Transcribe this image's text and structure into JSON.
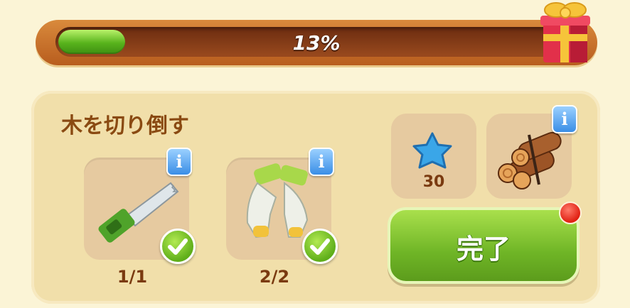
{
  "progress": {
    "label": "13%",
    "value": 0.13
  },
  "task": {
    "title": "木を切り倒す"
  },
  "requirements": [
    {
      "item": "saw-icon",
      "count": "1/1",
      "completed": true
    },
    {
      "item": "gloves-icon",
      "count": "2/2",
      "completed": true
    }
  ],
  "rewards": [
    {
      "item": "blue-star-icon",
      "amount": "30"
    },
    {
      "item": "logs-icon",
      "amount": ""
    }
  ],
  "complete_button": {
    "label": "完了"
  },
  "colors": {
    "accent_green": "#6fb526",
    "title_brown": "#8a4a12",
    "info_blue": "#3a8ee6"
  }
}
